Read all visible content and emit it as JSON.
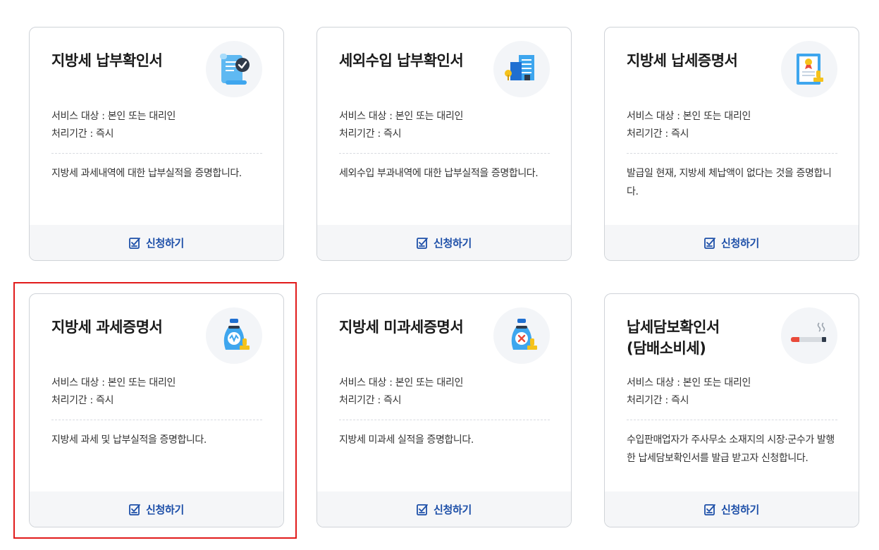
{
  "common": {
    "target_label": "서비스 대상 : 본인 또는 대리인",
    "period_label": "처리기간 : 즉시",
    "apply_label": "신청하기"
  },
  "cards": [
    {
      "title": "지방세 납부확인서",
      "desc": "지방세 과세내역에 대한 납부실적을 증명합니다.",
      "icon": "scroll-check-icon"
    },
    {
      "title": "세외수입 납부확인서",
      "desc": "세외수입 부과내역에 대한 납부실적을 증명합니다.",
      "icon": "buildings-icon"
    },
    {
      "title": "지방세 납세증명서",
      "desc": "발급일 현재, 지방세 체납액이 없다는 것을 증명합니다.",
      "icon": "certificate-icon"
    },
    {
      "title": "지방세 과세증명서",
      "desc": "지방세 과세 및 납부실적을 증명합니다.",
      "icon": "money-bag-stamp-icon"
    },
    {
      "title": "지방세 미과세증명서",
      "desc": "지방세 미과세 실적을 증명합니다.",
      "icon": "money-bag-x-icon"
    },
    {
      "title": "납세담보확인서\n(담배소비세)",
      "desc": "수입판매업자가 주사무소 소재지의 시장·군수가 발행한 납세담보확인서를 발급 받고자 신청합니다.",
      "icon": "cigarette-icon"
    }
  ],
  "colors": {
    "accent": "#1d4fa8",
    "highlight": "#e11b1b",
    "icon_blue": "#3ea6ee",
    "icon_yellow": "#f5c21b"
  }
}
